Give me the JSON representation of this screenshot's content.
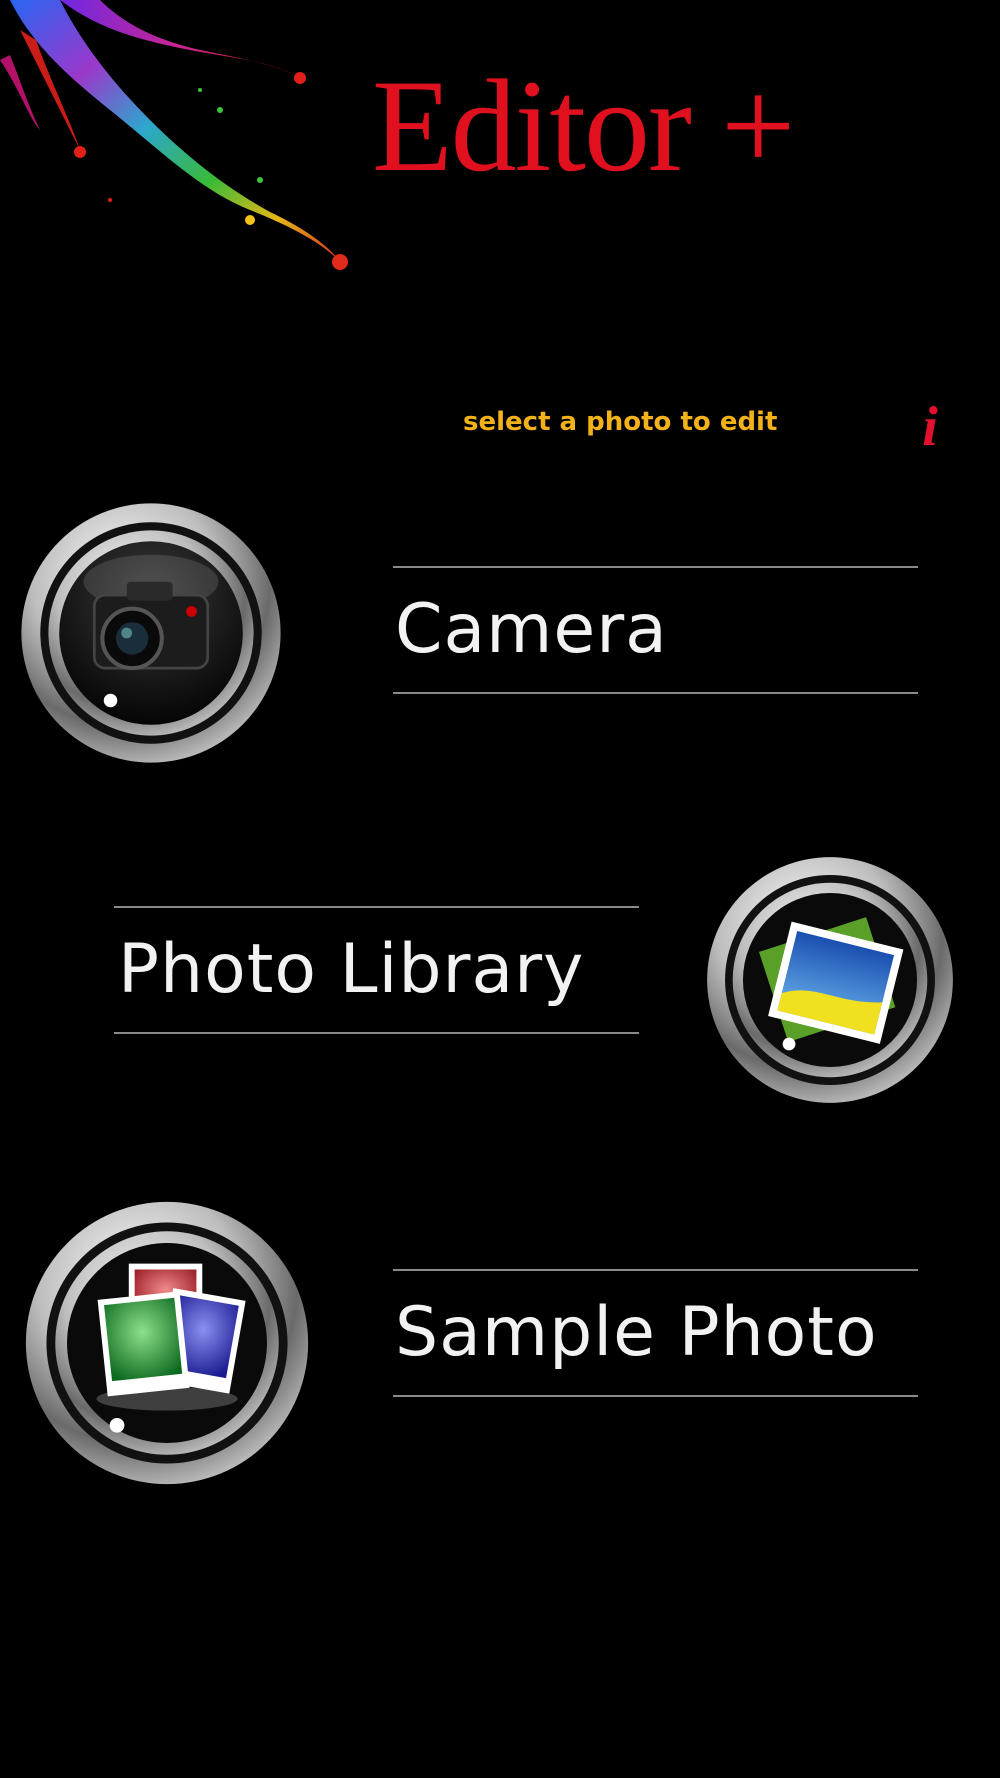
{
  "app": {
    "title": "Editor +",
    "subtitle": "select a photo to edit",
    "info_label": "i"
  },
  "options": {
    "camera": {
      "label": "Camera",
      "icon": "camera-icon"
    },
    "library": {
      "label": "Photo Library",
      "icon": "photo-library-icon"
    },
    "sample": {
      "label": "Sample Photo",
      "icon": "sample-photos-icon"
    }
  },
  "colors": {
    "background": "#000000",
    "title": "#e0101f",
    "subtitle": "#f4b21a",
    "info": "#e2102c",
    "label_text": "#f2f2f2",
    "divider": "#8a8a8a"
  }
}
